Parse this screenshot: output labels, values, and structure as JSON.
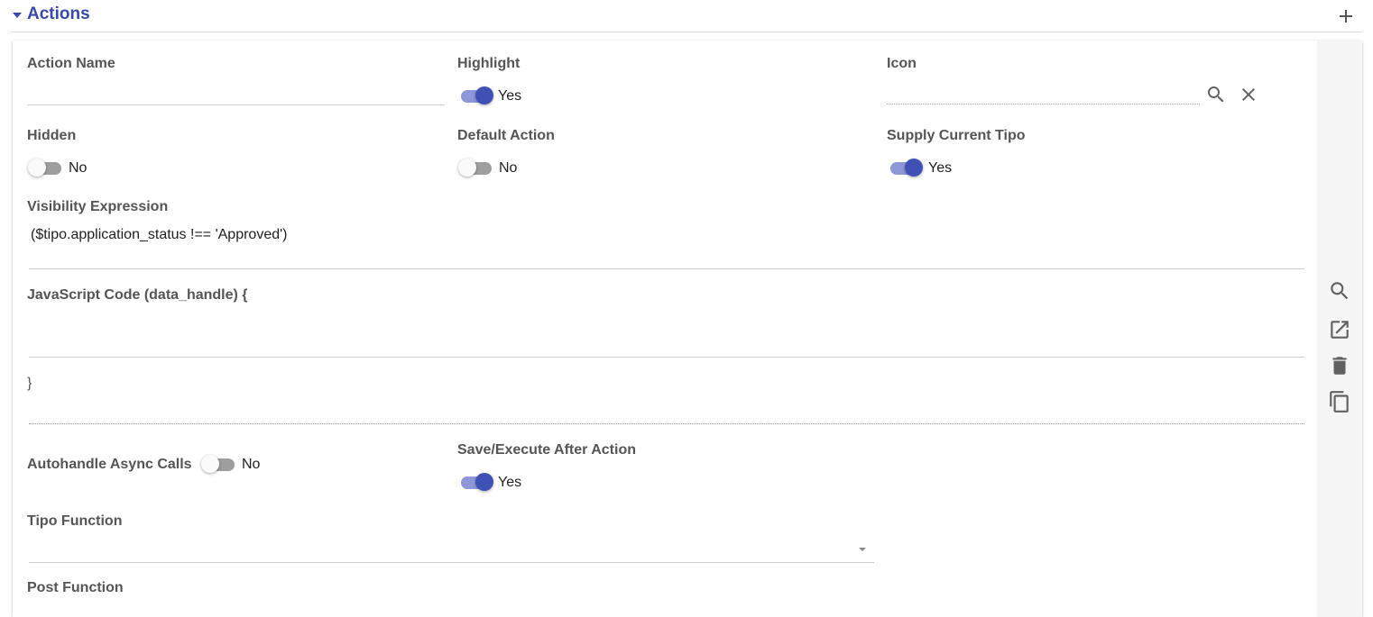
{
  "header": {
    "title": "Actions"
  },
  "fields": {
    "action_name": {
      "label": "Action Name",
      "value": ""
    },
    "highlight": {
      "label": "Highlight",
      "state": true,
      "state_label": "Yes"
    },
    "icon": {
      "label": "Icon",
      "value": ""
    },
    "hidden": {
      "label": "Hidden",
      "state": false,
      "state_label": "No"
    },
    "default_action": {
      "label": "Default Action",
      "state": false,
      "state_label": "No"
    },
    "supply_current_tipo": {
      "label": "Supply Current Tipo",
      "state": true,
      "state_label": "Yes"
    },
    "visibility_expression": {
      "label": "Visibility Expression",
      "value": "($tipo.application_status !== 'Approved')"
    },
    "javascript_code": {
      "label": "JavaScript Code (data_handle) {",
      "value": "",
      "closing": "}"
    },
    "autohandle_async": {
      "label": "Autohandle Async Calls",
      "state": false,
      "state_label": "No"
    },
    "save_execute": {
      "label": "Save/Execute After Action",
      "state": true,
      "state_label": "Yes"
    },
    "tipo_function": {
      "label": "Tipo Function",
      "value": ""
    },
    "post_function": {
      "label": "Post Function"
    }
  },
  "sidebar_icons": [
    "search-icon",
    "open-in-new-icon",
    "delete-icon",
    "copy-icon"
  ],
  "colors": {
    "accent": "#3f51b5",
    "title": "#3949ab"
  }
}
